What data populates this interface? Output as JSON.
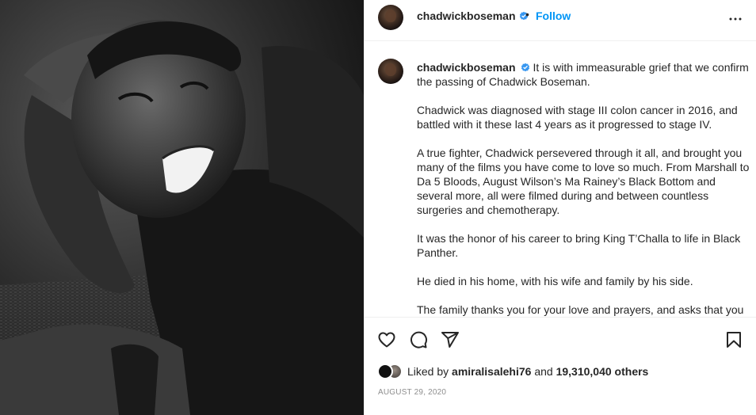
{
  "post": {
    "username": "chadwickboseman",
    "follow_label": "Follow",
    "separator": "•",
    "image_alt": "Black and white portrait of a smiling man leaning on his hand",
    "caption": {
      "username": "chadwickboseman",
      "paragraphs": [
        "It is with immeasurable grief that we confirm the passing of Chadwick Boseman.",
        "Chadwick was diagnosed with stage III colon cancer in 2016, and battled with it these last 4 years as it progressed to stage IV.",
        "A true fighter, Chadwick persevered through it all, and brought you many of the films you have come to love so much. From Marshall to Da 5 Bloods, August Wilson’s Ma Rainey’s Black Bottom and several more, all were filmed during and between countless surgeries and chemotherapy.",
        "It was the honor of his career to bring King T’Challa to life in Black Panther.",
        "He died in his home, with his wife and family by his side.",
        "The family thanks you for your love and prayers, and asks that you"
      ]
    },
    "likes": {
      "prefix": "Liked by",
      "user": "amiralisalehi76",
      "middle": "and",
      "count": "19,310,040 others"
    },
    "date": "AUGUST 29, 2020"
  },
  "icons": {
    "verified": "verified-badge-icon",
    "more": "more-options-icon",
    "like": "heart-icon",
    "comment": "comment-icon",
    "share": "share-icon",
    "save": "bookmark-icon"
  },
  "colors": {
    "accent": "#0095f6",
    "text": "#262626",
    "muted": "#8e8e8e",
    "border": "#efefef"
  }
}
